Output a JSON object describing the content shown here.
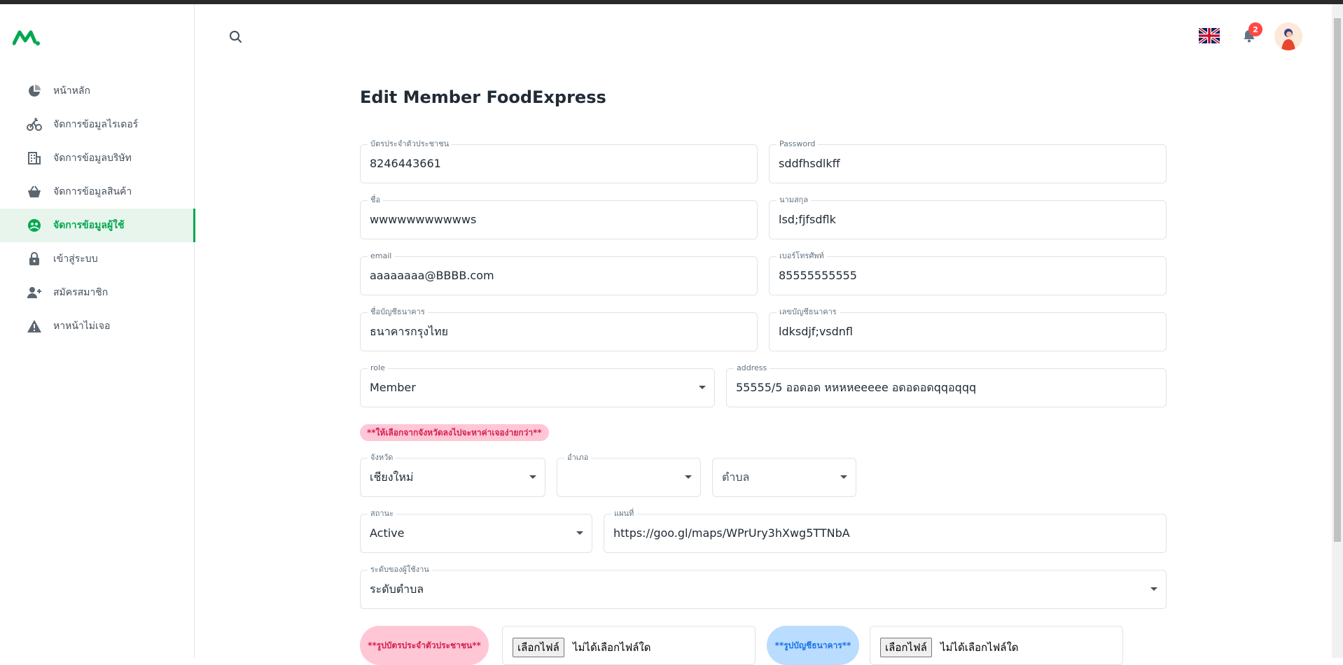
{
  "sidebar": {
    "items": [
      {
        "label": "หน้าหลัก",
        "icon": "pie-chart-icon"
      },
      {
        "label": "จัดการข้อมูลไรเดอร์",
        "icon": "bicycle-icon"
      },
      {
        "label": "จัดการข้อมูลบริษัท",
        "icon": "building-icon"
      },
      {
        "label": "จัดการข้อมูลสินค้า",
        "icon": "basket-icon"
      },
      {
        "label": "จัดการข้อมูลผู้ใช้",
        "icon": "user-circle-icon",
        "active": true
      },
      {
        "label": "เข้าสู่ระบบ",
        "icon": "lock-icon"
      },
      {
        "label": "สมัครสมาชิก",
        "icon": "user-plus-icon"
      },
      {
        "label": "หาหน้าไม่เจอ",
        "icon": "warning-icon"
      }
    ]
  },
  "header": {
    "notification_count": "2"
  },
  "page": {
    "title": "Edit Member FoodExpress"
  },
  "form": {
    "id_card": {
      "label": "บัตรประจำตัวประชาชน",
      "value": "8246443661"
    },
    "password": {
      "label": "Password",
      "value": "sddfhsdlkff"
    },
    "first_name": {
      "label": "ชื่อ",
      "value": "wwwwwwwwwwws"
    },
    "last_name": {
      "label": "นามสกุล",
      "value": "lsd;fjfsdflk"
    },
    "email": {
      "label": "email",
      "value": "aaaaaaaa@BBBB.com"
    },
    "phone": {
      "label": "เบอร์โทรศัพท์",
      "value": "85555555555"
    },
    "bank_name": {
      "label": "ชื่อบัญชีธนาคาร",
      "value": "ธนาคารกรุงไทย"
    },
    "bank_account": {
      "label": "เลขบัญชีธนาคาร",
      "value": "ldksdjf;vsdnfl"
    },
    "role": {
      "label": "role",
      "value": "Member"
    },
    "address": {
      "label": "address",
      "value": "55555/5 ออดอด หหหหeeeee อดอดอดqqอqqq"
    },
    "hint": "**ให้เลือกจากจังหวัดลงไปจะหาค่าเจอง่ายกว่า**",
    "province": {
      "label": "จังหวัด",
      "value": "เชียงใหม่"
    },
    "district": {
      "label": "อำเภอ",
      "value": ""
    },
    "subdistrict": {
      "placeholder": "ตำบล"
    },
    "status": {
      "label": "สถานะ",
      "value": "Active"
    },
    "map": {
      "label": "แผนที่",
      "value": "https://goo.gl/maps/WPrUry3hXwg5TTNbA"
    },
    "user_level": {
      "label": "ระดับของผู้ใช้งาน",
      "value": "ระดับตำบล"
    },
    "upload_id_card": {
      "tag": "**รูปบัตรประจำตัวประชาชน**",
      "button": "เลือกไฟล์",
      "status": "ไม่ได้เลือกไฟล์ใด"
    },
    "upload_bank": {
      "tag": "**รูปบัญชีธนาคาร**",
      "button": "เลือกไฟล์",
      "status": "ไม่ได้เลือกไฟล์ใด"
    }
  },
  "colors": {
    "accent": "#00a84f",
    "badge": "#ff4842",
    "pink_tag": "#ffc6d6",
    "blue_tag": "#b9dcff"
  }
}
